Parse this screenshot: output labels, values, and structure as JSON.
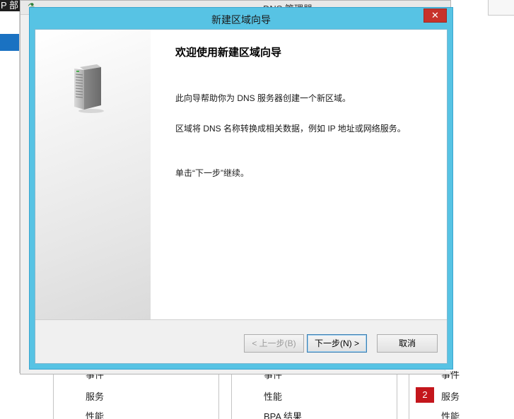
{
  "background": {
    "topleft_text": "P 部",
    "tiles": [
      {
        "rows": [
          "事件",
          "服务",
          "性能"
        ]
      },
      {
        "rows": [
          "事件",
          "性能",
          "BPA 结果"
        ]
      },
      {
        "badge": "2",
        "rows": [
          "事件",
          "服务",
          "性能"
        ]
      }
    ]
  },
  "dns_window": {
    "title": "DNS 管理器"
  },
  "wizard": {
    "title": "新建区域向导",
    "close_glyph": "✕",
    "heading": "欢迎使用新建区域向导",
    "paragraph1": "此向导帮助你为 DNS 服务器创建一个新区域。",
    "paragraph2": "区域将 DNS 名称转换成相关数据，例如 IP 地址或网络服务。",
    "paragraph3": "单击“下一步”继续。",
    "buttons": {
      "back": "< 上一步(B)",
      "next": "下一步(N) >",
      "cancel": "取消"
    }
  },
  "colors": {
    "title_bar": "#57c3e4",
    "close_button": "#c7322b",
    "selected_nav": "#1a72c2",
    "badge": "#c4161c"
  },
  "icons": {
    "wizard_art": "server-icon",
    "dns_app": "dns-app-icon"
  }
}
